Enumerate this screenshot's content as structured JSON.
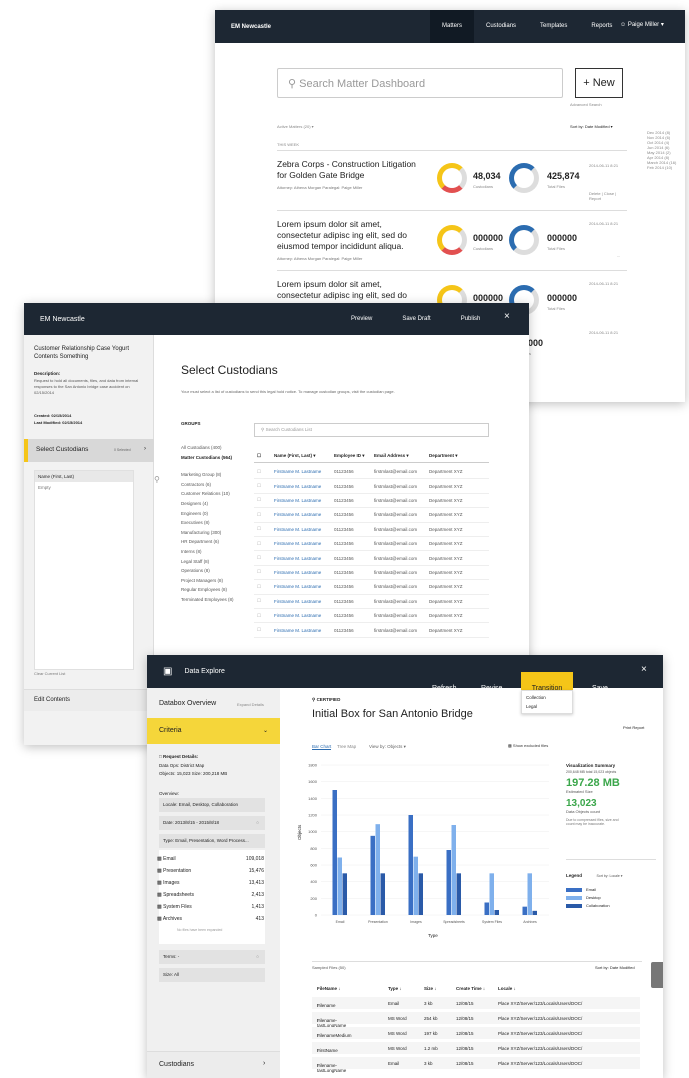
{
  "w1": {
    "brand": "EM Newcastle",
    "nav": [
      "Matters",
      "Custodians",
      "Templates",
      "Reports"
    ],
    "user": "Paige Miller",
    "search_placeholder": "Search Matter Dashboard",
    "new_label": "+ New",
    "advanced": "Advanced Search",
    "active_matters": "Active Matters (20) ▾",
    "sort": "Sort by: Date Modified ▾",
    "this_week": "THIS WEEK",
    "matters": [
      {
        "title": "Zebra Corps - Construction Litigation for Golden Gate Bridge",
        "meta": "Attorney: Athena Morgan   Paralegal: Paige Miller",
        "cust": "48,034",
        "cust_label": "Custodians",
        "files": "425,874",
        "files_label": "Total Files",
        "date": "2014-06-11 8:21",
        "actions": "Delete | Close | Report"
      },
      {
        "title": "Lorem ipsum dolor sit amet, consectetur adipisc ing elit, sed do eiusmod tempor incididunt aliqua.",
        "meta": "Attorney: Athena Morgan   Paralegal: Paige Miller",
        "cust": "000000",
        "cust_label": "Custodians",
        "files": "000000",
        "files_label": "Total Files",
        "date": "2014-06-11 8:21",
        "actions": "..."
      },
      {
        "title": "Lorem ipsum dolor sit amet, consectetur adipisc ing elit, sed do eiusmod tempor incididunt aliqua.",
        "meta": "",
        "cust": "000000",
        "cust_label": "Custodians",
        "files": "000000",
        "files_label": "Total Files",
        "date": "2014-06-11 8:21",
        "actions": ""
      }
    ],
    "dates": [
      "Dec 2014 (8)",
      "Nov 2014 (6)",
      "Oct 2014 (4)",
      "Jun 2014 (6)",
      "May 2014 (2)",
      "Apr 2014 (8)",
      "March 2014 (16)",
      "Feb 2014 (10)"
    ]
  },
  "w2": {
    "brand": "EM Newcastle",
    "actions": [
      "Preview",
      "Save Draft",
      "Publish"
    ],
    "close": "×",
    "case_title": "Customer Relationship Case Yogurt Contents Something",
    "desc_label": "Description:",
    "desc": "Request to hold all documents, files, and data from internal responses to the San Antonio bridge case accident on 02/15/2014",
    "created": "Created: 02/15/2014",
    "modified": "Last Modified: 02/15/2014",
    "step_select": "Select Custodians",
    "step_count": "0 Selected",
    "col_name": "Name (First, Last)",
    "empty": "Empty",
    "clear": "Clear Current List",
    "step_edit": "Edit Contents",
    "heading": "Select Custodians",
    "hint": "Your must select a list of custodians to send this legal hold notice. To manage custodian groups, visit the custodian page.",
    "groups_label": "GROUPS",
    "search_placeholder": "Search Custodians List",
    "groups": [
      "All Custodians (400)",
      "Matter Custodians (564)",
      "Marketing Group (8)",
      "Contractors (6)",
      "Customer Relations (10)",
      "Designers (4)",
      "Engineers (0)",
      "Executives (8)",
      "Manufacturing (300)",
      "HR Department (6)",
      "Interns (8)",
      "Legal Staff (8)",
      "Operations (8)",
      "Project Managers (8)",
      "Regular Employees (8)",
      "Terminated Employees (8)"
    ],
    "table_headers": [
      "Name (First, Last) ▾",
      "Employee ID ▾",
      "Email Address ▾",
      "Department ▾"
    ],
    "row": [
      "Firstname M. Lastname",
      "01123456",
      "firstmlast@email.com",
      "Department XYZ"
    ]
  },
  "w3": {
    "brand": "Data Explore",
    "actions": [
      "Refresh",
      "Revise",
      "Transition",
      "Save"
    ],
    "close": "×",
    "menu": [
      "Collection",
      "Legal"
    ],
    "overview": "Databox Overview",
    "expand": "Expand Details",
    "criteria": "Criteria",
    "req_details": "Request Details:",
    "data_ops": "Data Ops: District Map",
    "objects": "Objects: 15,023    Size: 200,218 MB",
    "overview_label": "Overview:",
    "locale": "Locale: Email, Desktop, Collaboration",
    "date": "Date: 2013/8/15 - 2015/8/18",
    "type": "Type: Email, Presentation, Word Process...",
    "file_types": [
      [
        "Email",
        "109,018"
      ],
      [
        "Presentation",
        "15,476"
      ],
      [
        "Images",
        "13,413"
      ],
      [
        "Spreadsheets",
        "2,413"
      ],
      [
        "System Files",
        "1,413"
      ],
      [
        "Archives",
        "413"
      ]
    ],
    "no_files": "No files have been expanded",
    "terms": "Terms: -",
    "size": "Size: All",
    "custodians": "Custodians",
    "breadcrumb": "CERTIFIED",
    "title": "Initial Box for San Antonio Bridge",
    "print": "Print Report",
    "tab_bar": "Bar Chart",
    "tab_tree": "Tree Map",
    "view_by": "View by: Objects ▾",
    "show_excluded": "Show excluded files",
    "xlabel": "Type",
    "ylabel": "Objects",
    "summary_title": "Visualization Summary",
    "summary_sub": "200,648 MB total  15,023 objects",
    "size_val": "197.28 MB",
    "size_label": "Estimated Size",
    "count_val": "13,023",
    "count_label": "Data Objects count",
    "note": "Due to compressed files, size and count may be inaccurate.",
    "legend_label": "Legend",
    "sort_by": "Sort by: Locale ▾",
    "sampled": "Sampled Files (50)",
    "sort_modified": "Sort by: Date Modified",
    "file_headers": [
      "FileName ↓",
      "Type ↓",
      "Size ↓",
      "Create Time ↓",
      "Locale ↓"
    ],
    "files": [
      [
        "Filename",
        "Email",
        "3 kb",
        "12/08/15",
        "Place XYZ/Server/123/Locals/Users/DOC/"
      ],
      [
        "Filename-tastLongName",
        "MS Word",
        "254 kb",
        "12/08/15",
        "Place XYZ/Server/123/Locals/Users/DOC/"
      ],
      [
        "FilenameMedium",
        "MS Word",
        "197 kb",
        "12/08/15",
        "Place XYZ/Server/123/Locals/Users/DOC/"
      ],
      [
        "FirstName",
        "MS Word",
        "1.2 mb",
        "12/08/15",
        "Place XYZ/Server/123/Locals/Users/DOC/"
      ],
      [
        "Filename-tastLongName",
        "Email",
        "3 kb",
        "12/08/15",
        "Place XYZ/Server/123/Locals/Users/DOC/"
      ]
    ]
  },
  "chart_data": {
    "type": "bar",
    "categories": [
      "Email",
      "Presentation",
      "Images",
      "Spreadsheets",
      "System Files",
      "Archives"
    ],
    "series": [
      {
        "name": "Email",
        "values": [
          1500,
          950,
          1200,
          780,
          150,
          100
        ]
      },
      {
        "name": "Desktop",
        "values": [
          690,
          1090,
          700,
          1080,
          500,
          500
        ]
      },
      {
        "name": "Collaboration",
        "values": [
          500,
          500,
          500,
          500,
          60,
          50
        ]
      }
    ],
    "ylabel": "Objects",
    "xlabel": "Type",
    "yticks": [
      "1800",
      "1600",
      "1400",
      "1200",
      "1000",
      "800",
      "600",
      "400",
      "200",
      "0"
    ],
    "ylim": [
      0,
      1800
    ],
    "colors": [
      "#3a6fc4",
      "#7fb0ec",
      "#2a5aa8"
    ]
  }
}
